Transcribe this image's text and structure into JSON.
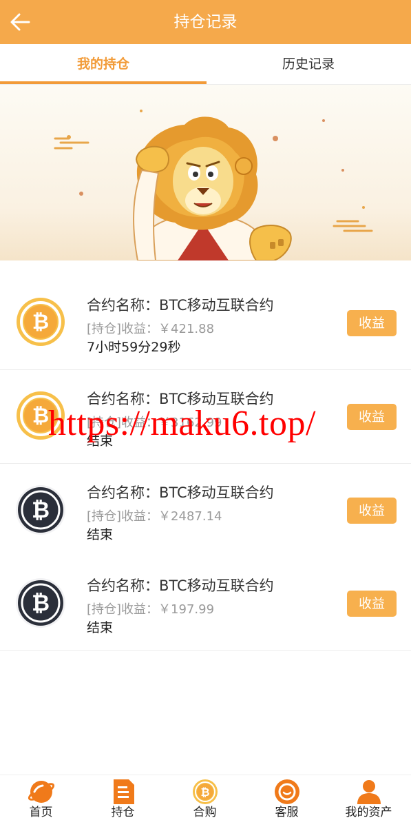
{
  "header": {
    "title": "持仓记录"
  },
  "tabs": [
    {
      "label": "我的持仓"
    },
    {
      "label": "历史记录"
    }
  ],
  "items": [
    {
      "name": "合约名称：BTC移动互联合约",
      "profit": "[持仓]收益：￥421.88",
      "status": "7小时59分29秒",
      "button": "收益",
      "icon": "bitcoin-gold-icon"
    },
    {
      "name": "合约名称：BTC移动互联合约",
      "profit": "[持仓]收益：￥3162.99",
      "status": "结束",
      "button": "收益",
      "icon": "bitcoin-gold-icon"
    },
    {
      "name": "合约名称：BTC移动互联合约",
      "profit": "[持仓]收益：￥2487.14",
      "status": "结束",
      "button": "收益",
      "icon": "bitcoin-dark-icon"
    },
    {
      "name": "合约名称：BTC移动互联合约",
      "profit": "[持仓]收益：￥197.99",
      "status": "结束",
      "button": "收益",
      "icon": "bitcoin-dark-icon"
    }
  ],
  "watermark": "https://maku6.top/",
  "tabbar": [
    {
      "label": "首页",
      "icon": "planet-icon"
    },
    {
      "label": "持仓",
      "icon": "document-icon"
    },
    {
      "label": "合购",
      "icon": "bitcoin-icon"
    },
    {
      "label": "客服",
      "icon": "chat-icon"
    },
    {
      "label": "我的资产",
      "icon": "user-icon"
    }
  ],
  "colors": {
    "accent": "#f5a94b",
    "tab_active": "#f29b38",
    "button": "#f7b04e"
  }
}
